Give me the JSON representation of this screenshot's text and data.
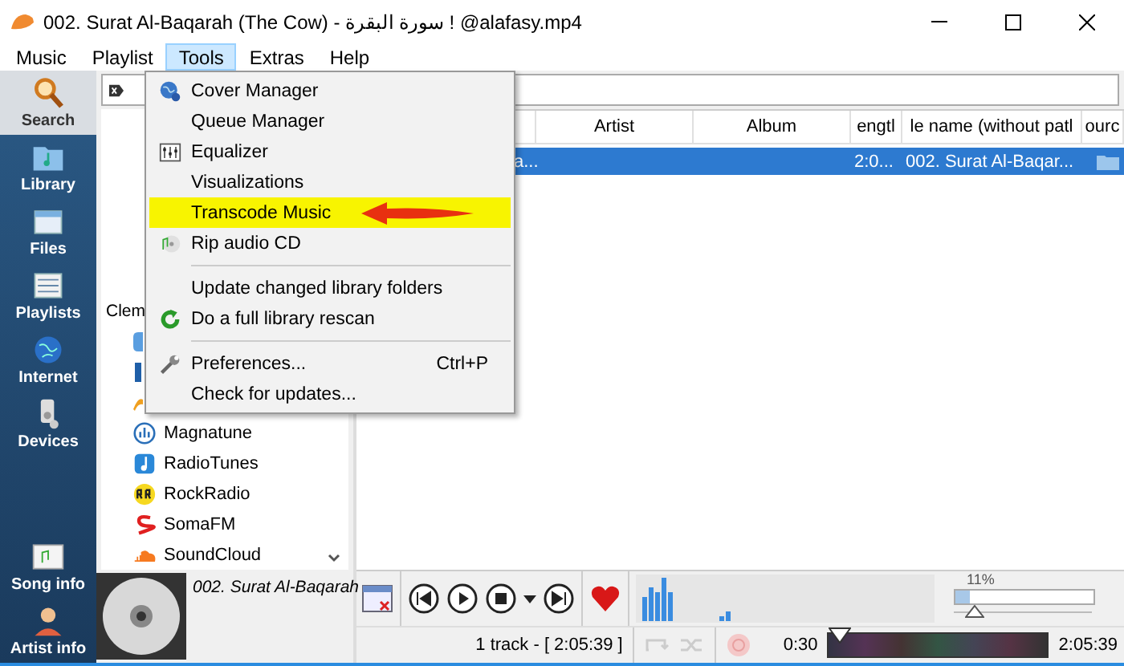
{
  "window": {
    "title": "002. Surat Al-Baqarah (The Cow) - سورة البقرة  ! @alafasy.mp4"
  },
  "menu_bar": [
    {
      "label": "Music",
      "selected": false
    },
    {
      "label": "Playlist",
      "selected": false
    },
    {
      "label": "Tools",
      "selected": true
    },
    {
      "label": "Extras",
      "selected": false
    },
    {
      "label": "Help",
      "selected": false
    }
  ],
  "sidebar": {
    "items": [
      {
        "label": "Search",
        "kind": "search",
        "selected": true
      },
      {
        "label": "Library",
        "kind": "library",
        "selected": false
      },
      {
        "label": "Files",
        "kind": "files",
        "selected": false
      },
      {
        "label": "Playlists",
        "kind": "playlists",
        "selected": false
      },
      {
        "label": "Internet",
        "kind": "internet",
        "selected": false
      },
      {
        "label": "Devices",
        "kind": "devices",
        "selected": false
      },
      {
        "label": "Song info",
        "kind": "songinfo",
        "selected": false
      },
      {
        "label": "Artist info",
        "kind": "artistinfo",
        "selected": false
      }
    ]
  },
  "internet_panel": {
    "heading": "Clem",
    "items": [
      {
        "label": "Magnatune",
        "kind": "magnatune"
      },
      {
        "label": "RadioTunes",
        "kind": "radiotunes"
      },
      {
        "label": "RockRadio",
        "kind": "rockradio"
      },
      {
        "label": "SomaFM",
        "kind": "somafm"
      },
      {
        "label": "SoundCloud",
        "kind": "soundcloud"
      }
    ]
  },
  "now_playing": {
    "title": "002. Surat Al-Baqarah"
  },
  "playlist": {
    "columns": [
      "",
      "Artist",
      "Album",
      "engtl",
      "le name (without patl",
      "ourc"
    ],
    "rows": [
      {
        "cells": [
          "a...",
          "",
          "",
          "2:0...",
          "002. Surat Al-Baqar..."
        ],
        "selected": true
      }
    ]
  },
  "tools_menu": {
    "items": [
      {
        "kind": "cover",
        "label": "Cover Manager",
        "highlighted": false
      },
      {
        "kind": "plain",
        "label": "Queue Manager",
        "highlighted": false
      },
      {
        "kind": "equalizer",
        "label": "Equalizer",
        "highlighted": false
      },
      {
        "kind": "plain",
        "label": "Visualizations",
        "highlighted": false
      },
      {
        "kind": "plain",
        "label": "Transcode Music",
        "highlighted": true
      },
      {
        "kind": "rip",
        "label": "Rip audio CD",
        "highlighted": false
      },
      {
        "kind": "separator"
      },
      {
        "kind": "plain",
        "label": "Update changed library folders",
        "highlighted": false
      },
      {
        "kind": "rescan",
        "label": "Do a full library rescan",
        "highlighted": false
      },
      {
        "kind": "separator"
      },
      {
        "kind": "preferences",
        "label": "Preferences...",
        "shortcut": "Ctrl+P",
        "highlighted": false
      },
      {
        "kind": "plain",
        "label": "Check for updates...",
        "highlighted": false
      }
    ]
  },
  "player": {
    "volume_reading": "11%",
    "volume": {
      "level": 0.11
    }
  },
  "status_bar": {
    "track_summary": "1 track - [ 2:05:39 ]",
    "elapsed": "0:30",
    "seek": {
      "level": 0.01
    },
    "total": "2:05:39"
  }
}
